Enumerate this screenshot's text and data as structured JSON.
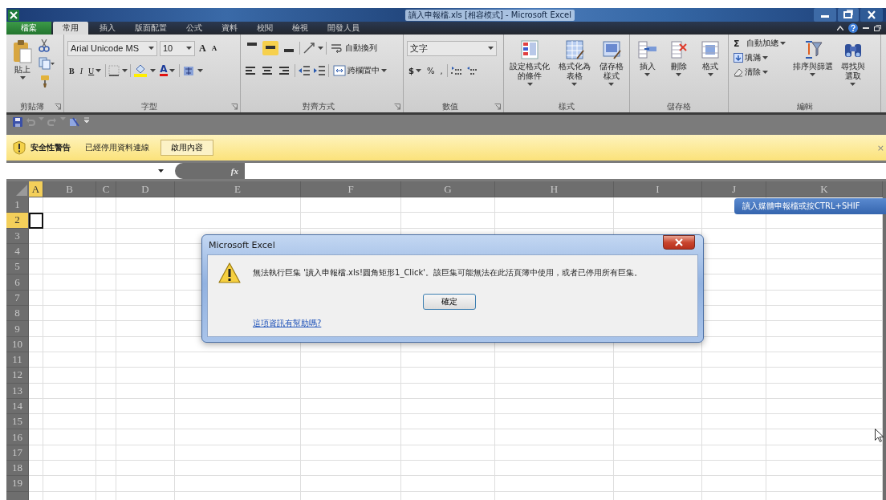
{
  "window": {
    "title": "讀入申報檔.xls [相容模式] - Microsoft Excel"
  },
  "ribbon_tabs": [
    {
      "label": "檔案",
      "kind": "file",
      "selected": false
    },
    {
      "label": "常用",
      "kind": "tab",
      "selected": true
    },
    {
      "label": "插入",
      "kind": "tab",
      "selected": false
    },
    {
      "label": "版面配置",
      "kind": "tab",
      "selected": false
    },
    {
      "label": "公式",
      "kind": "tab",
      "selected": false
    },
    {
      "label": "資料",
      "kind": "tab",
      "selected": false
    },
    {
      "label": "校閱",
      "kind": "tab",
      "selected": false
    },
    {
      "label": "檢視",
      "kind": "tab",
      "selected": false
    },
    {
      "label": "開發人員",
      "kind": "tab",
      "selected": false
    }
  ],
  "clipboard": {
    "paste": "貼上",
    "label": "剪貼簿"
  },
  "font": {
    "name": "Arial Unicode MS",
    "size": "10",
    "grow": "A",
    "shrink": "A",
    "bold": "B",
    "italic": "I",
    "underline": "U",
    "font_color_label": "A",
    "label": "字型"
  },
  "alignment": {
    "vertical": [
      {
        "selected": false
      },
      {
        "selected": true
      },
      {
        "selected": false
      }
    ],
    "wrap": "自動換列",
    "merge": "跨欄置中",
    "label": "對齊方式"
  },
  "number": {
    "format": "文字",
    "currency": "$",
    "percent": "%",
    "comma": ",",
    "label": "數值"
  },
  "styles": {
    "buttons": [
      "設定格式化的條件",
      "格式化為表格",
      "儲存格樣式"
    ],
    "label": "樣式"
  },
  "cells": {
    "buttons": [
      "插入",
      "刪除",
      "格式"
    ],
    "label": "儲存格"
  },
  "editing": {
    "autosum_symbol": "Σ",
    "autosum": "自動加總",
    "fill": "填滿",
    "clear": "清除",
    "sort": "排序與篩選",
    "find": "尋找與選取",
    "label": "編輯"
  },
  "security_bar": {
    "title": "安全性警告",
    "message": "已經停用資料連線",
    "button": "啟用內容",
    "close": "×"
  },
  "formula_bar": {
    "function": "fx"
  },
  "sheet": {
    "columns": [
      {
        "label": "A",
        "selected": true
      },
      {
        "label": "B",
        "selected": false
      },
      {
        "label": "C",
        "selected": false
      },
      {
        "label": "D",
        "selected": false
      },
      {
        "label": "E",
        "selected": false
      },
      {
        "label": "F",
        "selected": false
      },
      {
        "label": "G",
        "selected": false
      },
      {
        "label": "H",
        "selected": false
      },
      {
        "label": "I",
        "selected": false
      },
      {
        "label": "J",
        "selected": false
      },
      {
        "label": "K",
        "selected": false
      }
    ],
    "rows": [
      {
        "label": "1",
        "selected": false
      },
      {
        "label": "2",
        "selected": true
      },
      {
        "label": "3",
        "selected": false
      },
      {
        "label": "4",
        "selected": false
      },
      {
        "label": "5",
        "selected": false
      },
      {
        "label": "6",
        "selected": false
      },
      {
        "label": "7",
        "selected": false
      },
      {
        "label": "8",
        "selected": false
      },
      {
        "label": "9",
        "selected": false
      },
      {
        "label": "10",
        "selected": false
      },
      {
        "label": "11",
        "selected": false
      },
      {
        "label": "12",
        "selected": false
      },
      {
        "label": "13",
        "selected": false
      },
      {
        "label": "14",
        "selected": false
      },
      {
        "label": "15",
        "selected": false
      },
      {
        "label": "16",
        "selected": false
      },
      {
        "label": "17",
        "selected": false
      },
      {
        "label": "18",
        "selected": false
      },
      {
        "label": "19",
        "selected": false
      }
    ]
  },
  "dialog": {
    "title": "Microsoft Excel",
    "message": "無法執行巨集 '讀入申報檔.xls!圓角矩形1_Click'。該巨集可能無法在此活頁簿中使用，或者已停用所有巨集。",
    "button": "確定",
    "link": "這項資訊有幫助嗎?"
  },
  "tooltip": "讀入媒體申報檔或按CTRL+SHIF"
}
